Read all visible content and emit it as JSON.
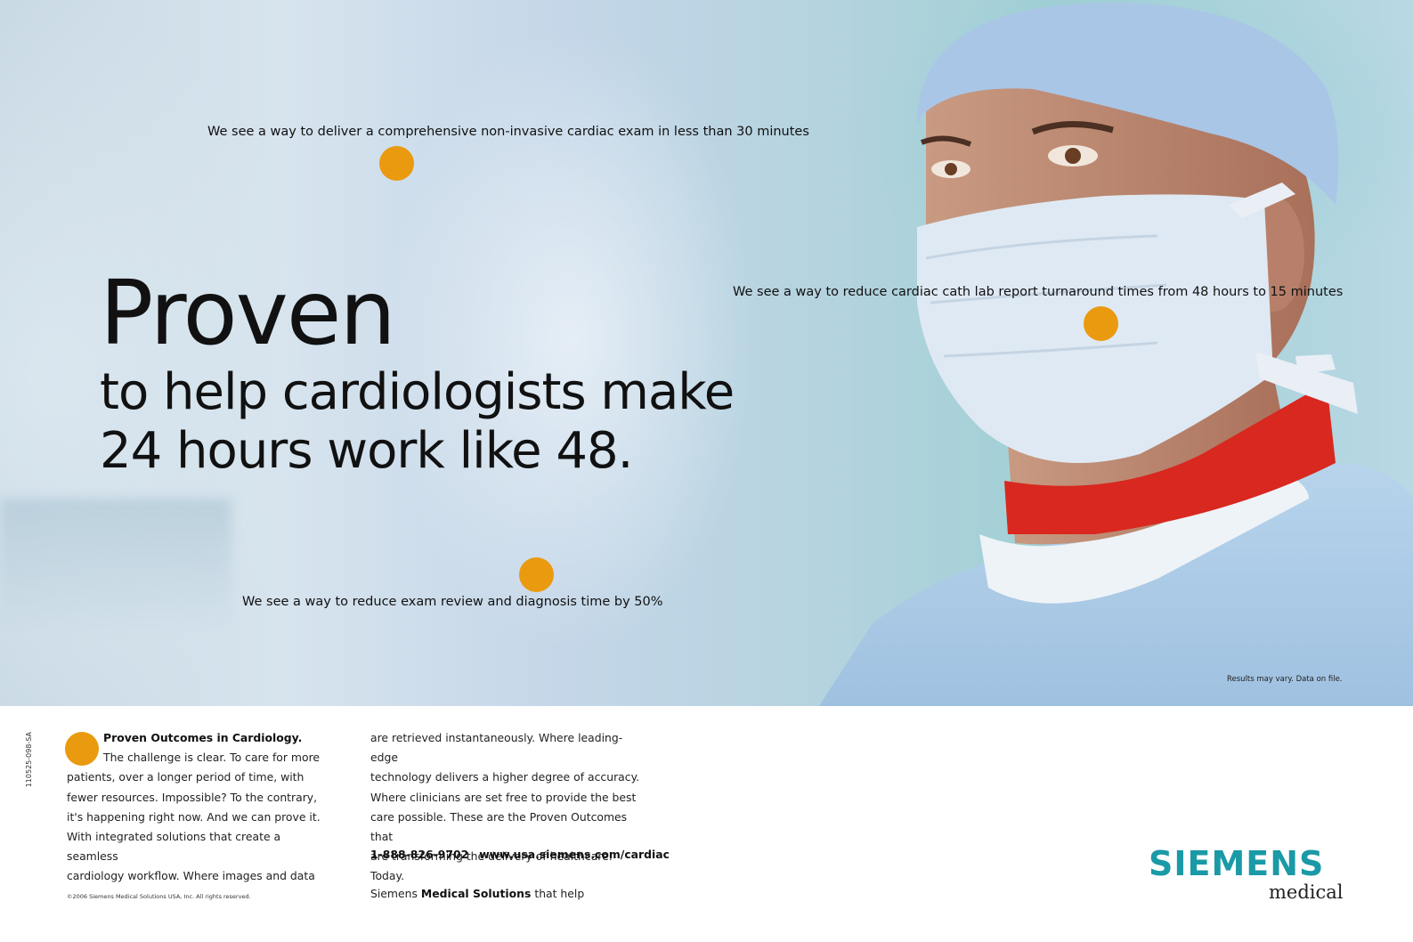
{
  "hero": {
    "callouts": [
      "We see a way to deliver a comprehensive non-invasive cardiac exam in less than 30 minutes",
      "We see a way to reduce cardiac cath lab report turnaround times from 48 hours to 15 minutes",
      "We see a way to reduce exam review and diagnosis time by 50%"
    ],
    "headline_big": "Proven",
    "headline_line2": "to help cardiologists make",
    "headline_line3": "24 hours work like 48.",
    "disclaimer": "Results may vary. Data on file.",
    "accent_color": "#ea9a0f"
  },
  "side_code": "110525-098-SA",
  "body": {
    "heading": "Proven Outcomes in Cardiology.",
    "col1_lines": [
      "The challenge is clear. To care for more",
      "patients, over a longer period of time, with",
      "fewer resources. Impossible? To the contrary,",
      "it's happening right now. And we can prove it.",
      "With integrated solutions that create a seamless",
      "cardiology workflow. Where images and data"
    ],
    "col2_lines": [
      "are retrieved instantaneously. Where leading-edge",
      "technology delivers a higher degree of accuracy.",
      "Where clinicians are set free to provide the best",
      "care possible. These are the Proven Outcomes that",
      "are transforming the delivery of healthcare. Today."
    ],
    "phone": "1-888-826-9702",
    "url": "www.usa.siemens.com/cardiac",
    "tagline_pre": "Siemens ",
    "tagline_bold": "Medical Solutions",
    "tagline_post": " that help",
    "copyright": "©2006 Siemens Medical Solutions USA, Inc. All rights reserved."
  },
  "logo": {
    "brand": "SIEMENS",
    "sub": "medical",
    "brand_color": "#1a9aa6"
  }
}
